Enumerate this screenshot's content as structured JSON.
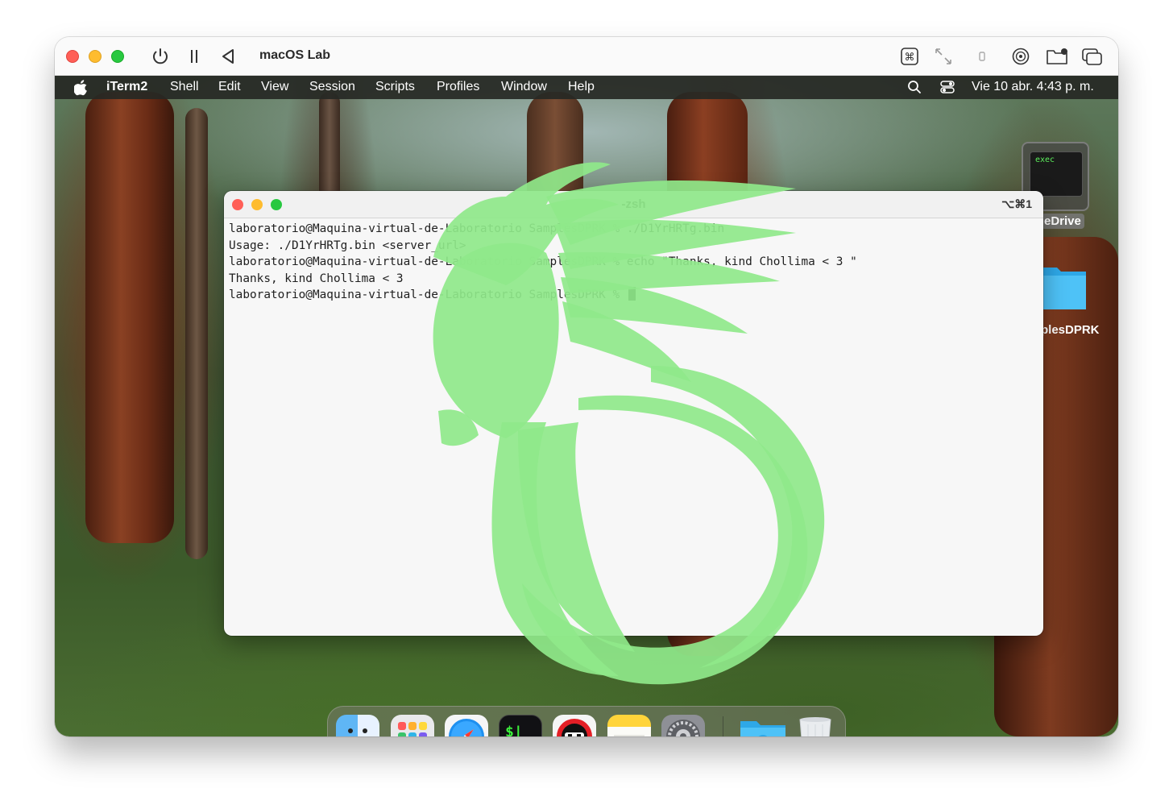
{
  "vm": {
    "title": "macOS Lab",
    "traffic_lights": {
      "close": "#ff5f57",
      "minimize": "#febc2e",
      "zoom": "#28c840"
    },
    "left_controls": [
      "power-icon",
      "pause-icon",
      "back-icon"
    ],
    "right_controls": [
      "command-key-icon",
      "resize-arrows-icon",
      "usb-icon",
      "disc-icon",
      "shared-folder-icon",
      "windows-icon"
    ]
  },
  "menubar": {
    "app_name": "iTerm2",
    "items": [
      "Shell",
      "Edit",
      "View",
      "Session",
      "Scripts",
      "Profiles",
      "Window",
      "Help"
    ],
    "clock": "Vie 10 abr.  4:43 p. m."
  },
  "terminal": {
    "title": "-zsh",
    "shortcut": "⌥⌘1",
    "lines": [
      "laboratorio@Maquina-virtual-de-Laboratorio SamplesDPRK % ./D1YrHRTg.bin",
      "Usage: ./D1YrHRTg.bin <server_url>",
      "laboratorio@Maquina-virtual-de-Laboratorio SamplesDPRK % echo \"Thanks, kind Chollima < 3 \"",
      "Thanks, kind Chollima < 3",
      "laboratorio@Maquina-virtual-de-Laboratorio SamplesDPRK % "
    ]
  },
  "desktop": {
    "thumbnail_text": "exec",
    "drive_label": "eDrive",
    "folder_label": "plesDPRK"
  },
  "dock": {
    "apps": [
      "finder",
      "launchpad",
      "safari",
      "terminal",
      "red-app",
      "notes",
      "system-settings",
      "downloads-folder",
      "trash"
    ]
  },
  "colors": {
    "watermark": "#8fe88a",
    "menubar_bg": "#262824",
    "terminal_bg": "#f7f7f7",
    "cursor": "#111111"
  }
}
